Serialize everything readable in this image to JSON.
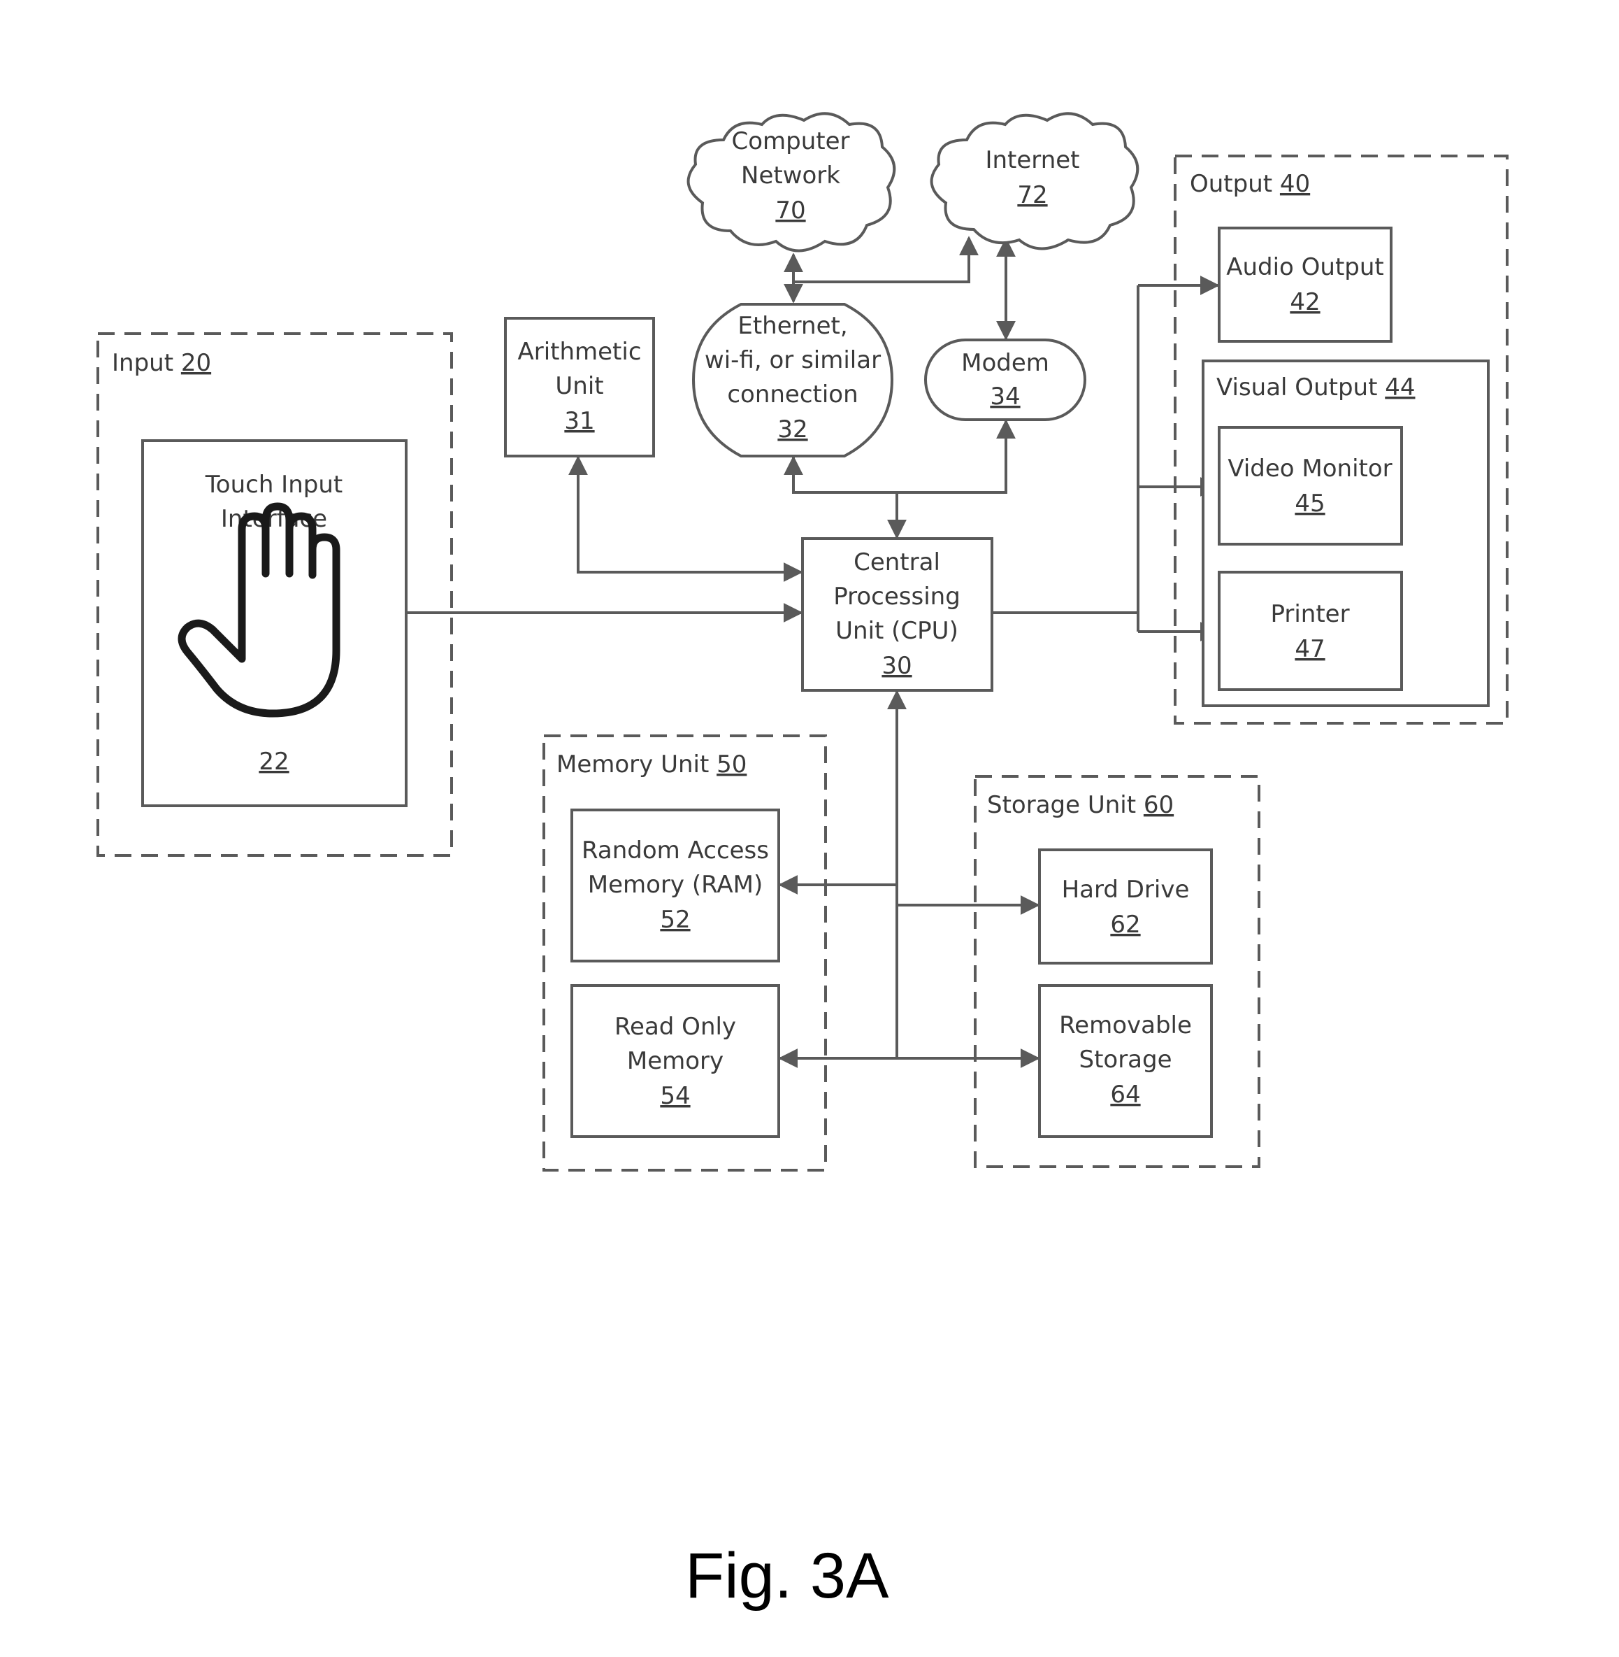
{
  "figure": {
    "caption": "Fig. 3A",
    "line_color": "#5a5a5a",
    "text_color": "#3a3a3a"
  },
  "groups": {
    "input": {
      "title": "Input",
      "ref": "20"
    },
    "output": {
      "title": "Output",
      "ref": "40"
    },
    "visual_output": {
      "title": "Visual Output",
      "ref": "44"
    },
    "memory": {
      "title": "Memory Unit",
      "ref": "50"
    },
    "storage": {
      "title": "Storage Unit",
      "ref": "60"
    }
  },
  "nodes": {
    "touch": {
      "lines": [
        "Touch Input",
        "Interface"
      ],
      "ref": "22",
      "icon": "hand-icon"
    },
    "cpu": {
      "lines": [
        "Central",
        "Processing",
        "Unit (CPU)"
      ],
      "ref": "30"
    },
    "arithmetic": {
      "lines": [
        "Arithmetic",
        "Unit"
      ],
      "ref": "31"
    },
    "ethernet": {
      "lines": [
        "Ethernet,",
        "wi-fi, or similar",
        "connection"
      ],
      "ref": "32"
    },
    "modem": {
      "lines": [
        "Modem"
      ],
      "ref": "34"
    },
    "audio": {
      "lines": [
        "Audio Output"
      ],
      "ref": "42"
    },
    "video": {
      "lines": [
        "Video Monitor"
      ],
      "ref": "45"
    },
    "printer": {
      "lines": [
        "Printer"
      ],
      "ref": "47"
    },
    "ram": {
      "lines": [
        "Random Access",
        "Memory (RAM)"
      ],
      "ref": "52"
    },
    "rom": {
      "lines": [
        "Read Only",
        "Memory"
      ],
      "ref": "54"
    },
    "hdd": {
      "lines": [
        "Hard Drive"
      ],
      "ref": "62"
    },
    "removable": {
      "lines": [
        "Removable",
        "Storage"
      ],
      "ref": "64"
    },
    "network": {
      "lines": [
        "Computer",
        "Network"
      ],
      "ref": "70"
    },
    "internet": {
      "lines": [
        "Internet"
      ],
      "ref": "72"
    }
  },
  "connections": [
    {
      "from": "touch",
      "to": "cpu",
      "direction": "to"
    },
    {
      "from": "arithmetic",
      "to": "cpu",
      "direction": "both"
    },
    {
      "from": "cpu",
      "to": "ethernet",
      "direction": "both"
    },
    {
      "from": "cpu",
      "to": "modem",
      "direction": "both"
    },
    {
      "from": "ethernet",
      "to": "network",
      "direction": "both"
    },
    {
      "from": "ethernet",
      "to": "internet",
      "direction": "both"
    },
    {
      "from": "modem",
      "to": "internet",
      "direction": "both"
    },
    {
      "from": "cpu",
      "to": "audio",
      "direction": "to"
    },
    {
      "from": "cpu",
      "to": "video",
      "direction": "to"
    },
    {
      "from": "cpu",
      "to": "printer",
      "direction": "to"
    },
    {
      "from": "cpu",
      "to": "ram",
      "direction": "both"
    },
    {
      "from": "cpu",
      "to": "rom",
      "direction": "both"
    },
    {
      "from": "cpu",
      "to": "hdd",
      "direction": "both"
    },
    {
      "from": "cpu",
      "to": "removable",
      "direction": "both"
    }
  ]
}
